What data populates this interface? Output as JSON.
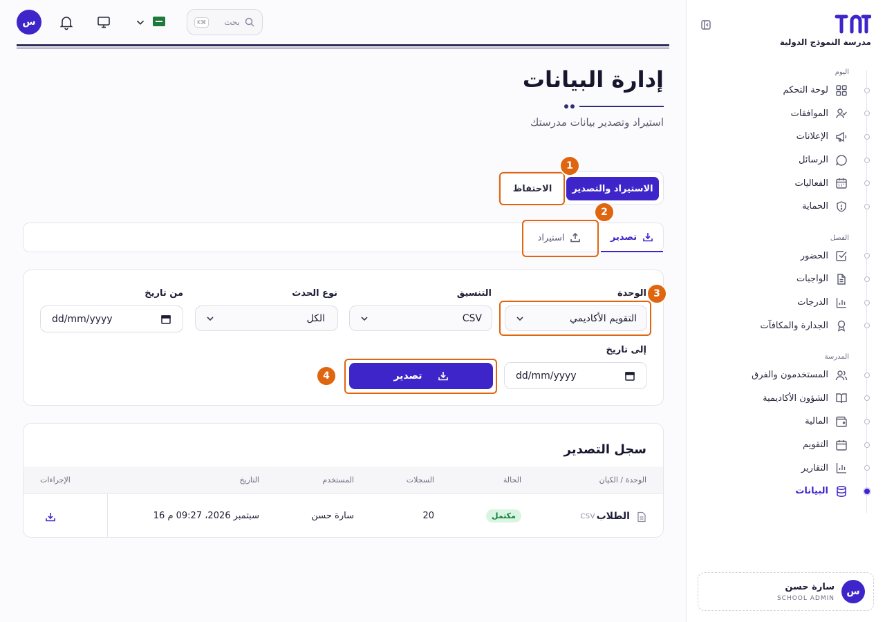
{
  "school": {
    "name": "مدرسة النموذج الدولية"
  },
  "sidebar": {
    "sections": [
      {
        "title": "اليوم",
        "items": [
          {
            "label": "لوحة التحكم",
            "icon": "dashboard-icon"
          },
          {
            "label": "الموافقات",
            "icon": "user-check-icon"
          },
          {
            "label": "الإعلانات",
            "icon": "megaphone-icon"
          },
          {
            "label": "الرسائل",
            "icon": "message-icon"
          },
          {
            "label": "الفعاليات",
            "icon": "calendar-icon"
          },
          {
            "label": "الحماية",
            "icon": "shield-icon"
          }
        ]
      },
      {
        "title": "الفصل",
        "items": [
          {
            "label": "الحضور",
            "icon": "checkbox-icon"
          },
          {
            "label": "الواجبات",
            "icon": "document-icon"
          },
          {
            "label": "الدرجات",
            "icon": "bar-chart-icon"
          },
          {
            "label": "الجدارة والمكافآت",
            "icon": "award-icon"
          }
        ]
      },
      {
        "title": "المدرسة",
        "items": [
          {
            "label": "المستخدمون والفرق",
            "icon": "users-icon"
          },
          {
            "label": "الشؤون الأكاديمية",
            "icon": "book-icon"
          },
          {
            "label": "المالية",
            "icon": "wallet-icon"
          },
          {
            "label": "التقويم",
            "icon": "calendar-icon"
          },
          {
            "label": "التقارير",
            "icon": "bar-chart-icon"
          },
          {
            "label": "البيانات",
            "icon": "database-icon",
            "active": true
          }
        ]
      }
    ]
  },
  "user": {
    "name": "سارة حسن",
    "role": "SCHOOL ADMIN",
    "initial": "س"
  },
  "topbar": {
    "search_placeholder": "بحث",
    "shortcut": "K⌘"
  },
  "page": {
    "title": "إدارة البيانات",
    "subtitle": "استيراد وتصدير بيانات مدرستك"
  },
  "main_tabs": {
    "active": "الاستيراد والتصدير",
    "inactive": "الاحتفاظ"
  },
  "sub_tabs": {
    "active": "تصدير",
    "inactive": "استيراد"
  },
  "filters": {
    "unit_label": "الوحدة",
    "unit_value": "التقويم الأكاديمي",
    "format_label": "التنسيق",
    "format_value": "CSV",
    "event_label": "نوع الحدث",
    "event_value": "الكل",
    "from_label": "من تاريخ",
    "from_placeholder": "dd/mm/yyyy",
    "to_label": "إلى تاريخ",
    "to_placeholder": "dd/mm/yyyy",
    "export_button": "تصدير"
  },
  "export_log": {
    "title": "سجل التصدير",
    "headers": {
      "entity": "الوحدة / الكيان",
      "status": "الحالة",
      "records": "السجلات",
      "user": "المستخدم",
      "date": "التاريخ",
      "actions": "الإجراءات"
    },
    "rows": [
      {
        "entity": "الطلاب",
        "format": "CSV",
        "status": "مكتمل",
        "records": "20",
        "user": "سارة حسن",
        "date": "16 سبتمبر 2026، 09:27 م"
      }
    ]
  },
  "annotations": [
    "1",
    "2",
    "3",
    "4"
  ],
  "colors": {
    "accent": "#3d25c9",
    "annotation": "#e0650f",
    "success_bg": "#d8f5e1",
    "success_text": "#14803c"
  }
}
